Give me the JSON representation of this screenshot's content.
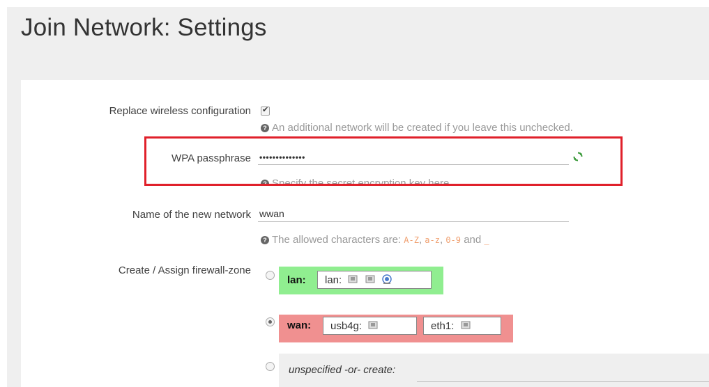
{
  "page": {
    "title": "Join Network: Settings"
  },
  "replace_wireless": {
    "label": "Replace wireless configuration",
    "checked": true,
    "hint": "An additional network will be created if you leave this unchecked."
  },
  "wpa": {
    "label": "WPA passphrase",
    "value": "••••••••••••••",
    "hint": "Specify the secret encryption key here."
  },
  "network_name": {
    "label": "Name of the new network",
    "value": "wwan",
    "hint_prefix": "The allowed characters are:",
    "range1": "A-Z",
    "sep1": ",",
    "range2": "a-z",
    "sep2": ",",
    "range3": "0-9",
    "and": "and",
    "underscore": "_"
  },
  "firewall": {
    "label": "Create / Assign firewall-zone",
    "zones": [
      {
        "name": "lan:",
        "ifaces": [
          "lan:"
        ],
        "color": "#90ee90",
        "selected": false
      },
      {
        "name": "wan:",
        "ifaces": [
          "usb4g:",
          "eth1:"
        ],
        "color": "#f09090",
        "selected": true
      }
    ],
    "unspecified_label": "unspecified -or- create:"
  },
  "colors": {
    "highlight": "#e0202a",
    "lan_zone": "#90ee90",
    "wan_zone": "#f09090",
    "refresh": "#3a9a3a"
  }
}
